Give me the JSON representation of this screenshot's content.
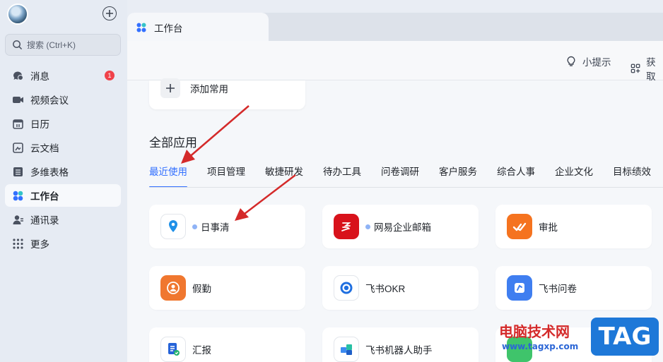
{
  "sidebar": {
    "search_placeholder": "搜索 (Ctrl+K)",
    "items": [
      {
        "label": "消息",
        "icon": "chat-bubble-icon",
        "badge": "1"
      },
      {
        "label": "视频会议",
        "icon": "video-camera-icon"
      },
      {
        "label": "日历",
        "icon": "calendar-icon"
      },
      {
        "label": "云文档",
        "icon": "cloud-doc-icon"
      },
      {
        "label": "多维表格",
        "icon": "table-icon"
      },
      {
        "label": "工作台",
        "icon": "workspace-icon",
        "active": true
      },
      {
        "label": "通讯录",
        "icon": "contacts-icon"
      },
      {
        "label": "更多",
        "icon": "grid-dots-icon"
      }
    ]
  },
  "tab": {
    "label": "工作台"
  },
  "toolbar": {
    "tips_label": "小提示",
    "get_label": "获取"
  },
  "add_common": {
    "label": "添加常用"
  },
  "section": {
    "title": "全部应用"
  },
  "categories": [
    "最近使用",
    "项目管理",
    "敏捷研发",
    "待办工具",
    "问卷调研",
    "客户服务",
    "综合人事",
    "企业文化",
    "目标绩效"
  ],
  "apps": [
    {
      "name": "日事清",
      "dot": true,
      "icon": "location-pin-icon",
      "color": "#ffffff"
    },
    {
      "name": "网易企业邮箱",
      "dot": true,
      "icon": "netease-logo-icon",
      "color": "#d8121b"
    },
    {
      "name": "审批",
      "dot": false,
      "icon": "approval-check-icon",
      "color": "#f5731f"
    },
    {
      "name": "假勤",
      "dot": false,
      "icon": "attendance-person-icon",
      "color": "#f0772f"
    },
    {
      "name": "飞书OKR",
      "dot": false,
      "icon": "target-ring-icon",
      "color": "#ffffff"
    },
    {
      "name": "飞书问卷",
      "dot": false,
      "icon": "survey-icon",
      "color": "#3f7ef0"
    },
    {
      "name": "汇报",
      "dot": false,
      "icon": "report-doc-icon",
      "color": "#ffffff"
    },
    {
      "name": "飞书机器人助手",
      "dot": false,
      "icon": "robot-blocks-icon",
      "color": "#ffffff"
    }
  ],
  "colors": {
    "accent": "#3370ff",
    "badge": "#f0424a",
    "annotation_arrow": "#d42a2a"
  },
  "watermark": {
    "site_name": "电脑技术网",
    "url": "www.tagxp.com",
    "brand": "TAG"
  }
}
